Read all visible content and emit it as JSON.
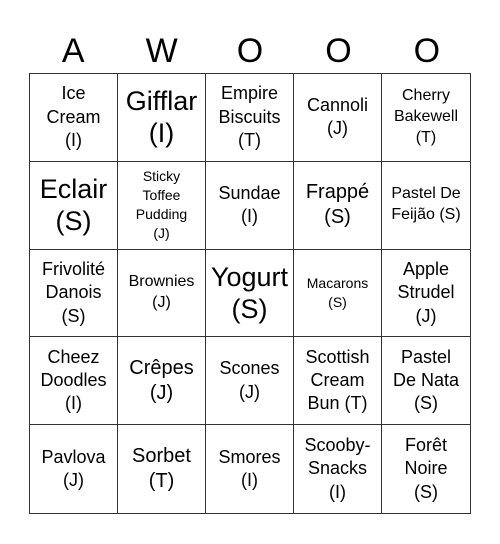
{
  "header": {
    "letters": [
      "A",
      "W",
      "O",
      "O",
      "O"
    ]
  },
  "cells": [
    {
      "text": "Ice\nCream\n(I)",
      "size": "s-m"
    },
    {
      "text": "Gifflar\n(I)",
      "size": "s-xl"
    },
    {
      "text": "Empire\nBiscuits\n(T)",
      "size": "s-m"
    },
    {
      "text": "Cannoli\n(J)",
      "size": "s-m"
    },
    {
      "text": "Cherry\nBakewell\n(T)",
      "size": "s-s"
    },
    {
      "text": "Eclair\n(S)",
      "size": "s-xl"
    },
    {
      "text": "Sticky\nToffee\nPudding\n(J)",
      "size": "s-xs"
    },
    {
      "text": "Sundae\n(I)",
      "size": "s-m"
    },
    {
      "text": "Frappé\n(S)",
      "size": "s-l"
    },
    {
      "text": "Pastel De\nFeijão (S)",
      "size": "s-s"
    },
    {
      "text": "Frivolité\nDanois\n(S)",
      "size": "s-m"
    },
    {
      "text": "Brownies\n(J)",
      "size": "s-s"
    },
    {
      "text": "Yogurt\n(S)",
      "size": "s-xl"
    },
    {
      "text": "Macarons\n(S)",
      "size": "s-xs"
    },
    {
      "text": "Apple\nStrudel\n(J)",
      "size": "s-m"
    },
    {
      "text": "Cheez\nDoodles\n(I)",
      "size": "s-m"
    },
    {
      "text": "Crêpes\n(J)",
      "size": "s-l"
    },
    {
      "text": "Scones\n(J)",
      "size": "s-m"
    },
    {
      "text": "Scottish\nCream\nBun (T)",
      "size": "s-m"
    },
    {
      "text": "Pastel\nDe Nata\n(S)",
      "size": "s-m"
    },
    {
      "text": "Pavlova\n(J)",
      "size": "s-m"
    },
    {
      "text": "Sorbet\n(T)",
      "size": "s-l"
    },
    {
      "text": "Smores\n(I)",
      "size": "s-m"
    },
    {
      "text": "Scooby-\nSnacks\n(I)",
      "size": "s-m"
    },
    {
      "text": "Forêt\nNoire\n(S)",
      "size": "s-m"
    }
  ]
}
